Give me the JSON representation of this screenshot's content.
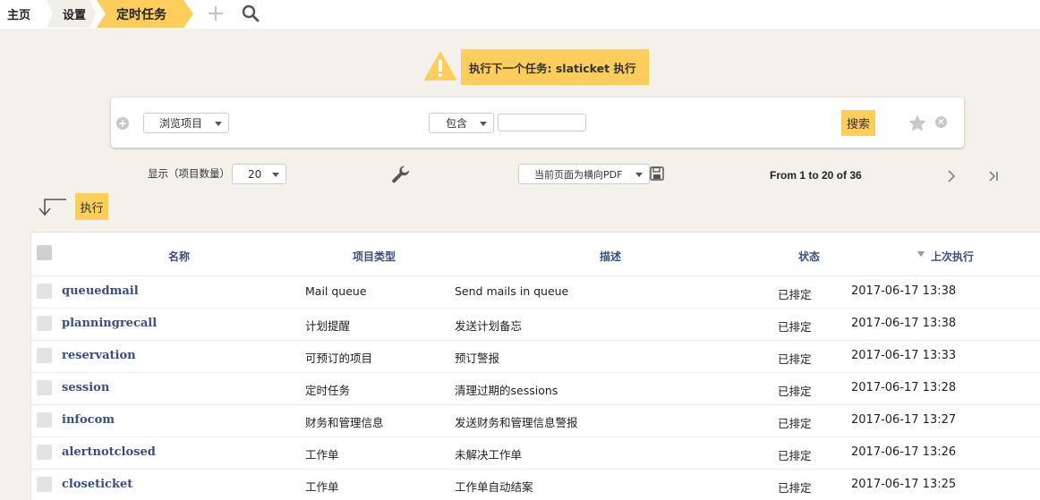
{
  "breadcrumb": {
    "home": "主页",
    "settings": "设置",
    "current": "定时任务"
  },
  "icons": {
    "add": "plus-icon",
    "search": "search-icon",
    "warning": "warning-icon",
    "star": "star-icon",
    "wrench": "wrench-icon",
    "save": "floppy-icon"
  },
  "warning": {
    "text": "执行下一个任务: slaticket  执行"
  },
  "search": {
    "field_select": "浏览项目",
    "operator_select": "包含",
    "value": "",
    "button": "搜索"
  },
  "toolbar": {
    "show_label": "显示（项目数量）",
    "page_size": "20",
    "export_select": "当前页面为横向PDF",
    "pager": "From 1 to 20 of 36"
  },
  "mass_action": {
    "execute": "执行"
  },
  "table": {
    "headers": {
      "name": "名称",
      "type": "项目类型",
      "description": "描述",
      "status": "状态",
      "last_run": "上次执行"
    },
    "rows": [
      {
        "name": "queuedmail",
        "type": "Mail queue",
        "description": "Send mails in queue",
        "status": "已排定",
        "last_run": "2017-06-17 13:38"
      },
      {
        "name": "planningrecall",
        "type": "计划提醒",
        "description": "发送计划备忘",
        "status": "已排定",
        "last_run": "2017-06-17 13:38"
      },
      {
        "name": "reservation",
        "type": "可预订的项目",
        "description": "预订警报",
        "status": "已排定",
        "last_run": "2017-06-17 13:33"
      },
      {
        "name": "session",
        "type": "定时任务",
        "description": "清理过期的sessions",
        "status": "已排定",
        "last_run": "2017-06-17 13:28"
      },
      {
        "name": "infocom",
        "type": "财务和管理信息",
        "description": "发送财务和管理信息警报",
        "status": "已排定",
        "last_run": "2017-06-17 13:27"
      },
      {
        "name": "alertnotclosed",
        "type": "工作单",
        "description": "未解决工作单",
        "status": "已排定",
        "last_run": "2017-06-17 13:26"
      },
      {
        "name": "closeticket",
        "type": "工作单",
        "description": "工作单自动结案",
        "status": "已排定",
        "last_run": "2017-06-17 13:25"
      }
    ]
  },
  "colors": {
    "accent": "#ffcd5c",
    "link": "#3a4f80",
    "background": "#f3f1ea"
  }
}
